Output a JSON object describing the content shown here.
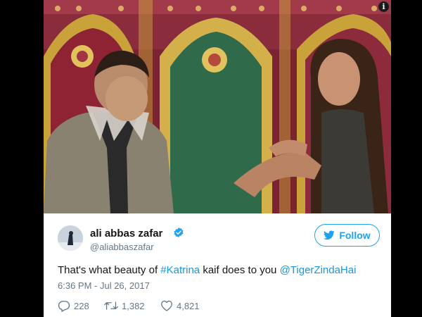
{
  "tweet": {
    "author_name": "ali abbas zafar",
    "author_handle": "@aliabbaszafar",
    "follow_label": "Follow",
    "text_intro": "That's what beauty of ",
    "hashtag": "#Katrina",
    "text_middle": " kaif does to you ",
    "mention": "@TigerZindaHai",
    "timestamp": "6:36 PM - Jul 26, 2017",
    "replies": "228",
    "retweets": "1,382",
    "likes": "4,821"
  },
  "colors": {
    "twitter_blue": "#1da1f2",
    "link_blue": "#1b95e0",
    "text": "#14171a",
    "muted": "#657786"
  },
  "icons": [
    "info-icon",
    "verified-icon",
    "twitter-bird-icon",
    "reply-icon",
    "retweet-icon",
    "like-icon"
  ]
}
